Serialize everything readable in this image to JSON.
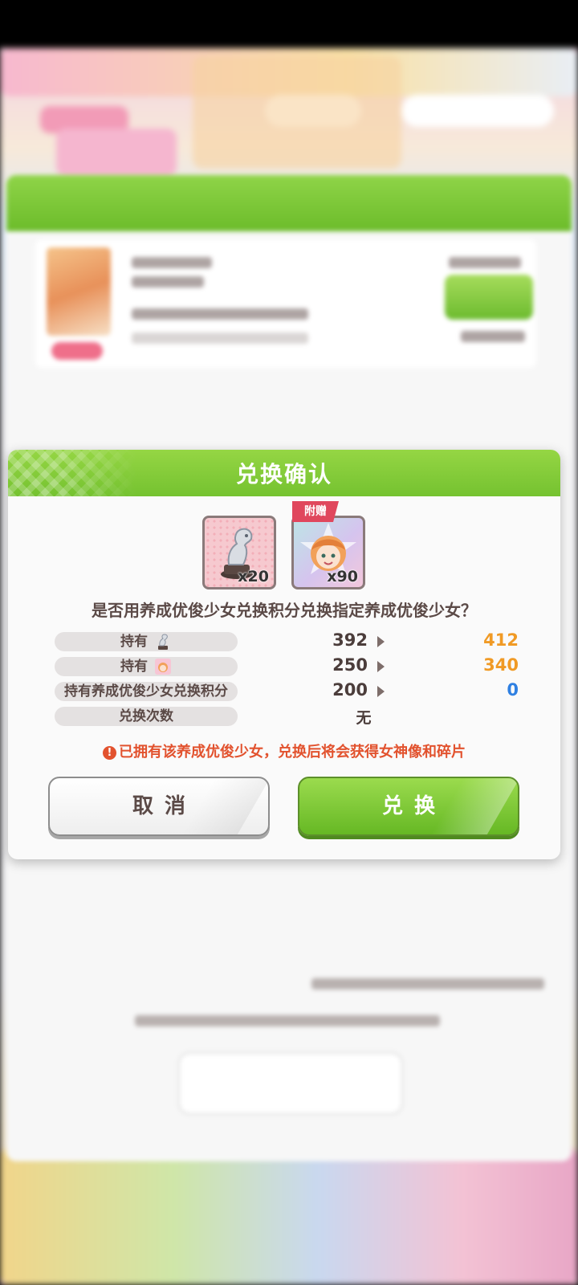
{
  "dialog": {
    "title": "兑换确认",
    "items": [
      {
        "icon": "trophy-statue-icon",
        "count": "x20"
      },
      {
        "icon": "character-portrait-icon",
        "count": "x90",
        "tag": "附赠"
      }
    ],
    "question": "是否用养成优俊少女兑换积分兑换指定养成优俊少女？",
    "rows": [
      {
        "label": "持有",
        "icon": "trophy-statue-icon",
        "before": "392",
        "after": "412"
      },
      {
        "label": "持有",
        "icon": "character-portrait-icon",
        "before": "250",
        "after": "340"
      },
      {
        "label": "持有养成优俊少女兑换积分",
        "before": "200",
        "after": "0"
      },
      {
        "label": "兑换次数",
        "value": "无"
      }
    ],
    "warning": "已拥有该养成优俊少女，兑换后将会获得女神像和碎片",
    "cancel_label": "取消",
    "confirm_label": "兑换"
  },
  "colors": {
    "header_green": "#75c230",
    "after_orange": "#f09a25",
    "after_blue": "#2f80e2",
    "warning_red": "#e2522e",
    "gift_tag": "#e0475d"
  }
}
